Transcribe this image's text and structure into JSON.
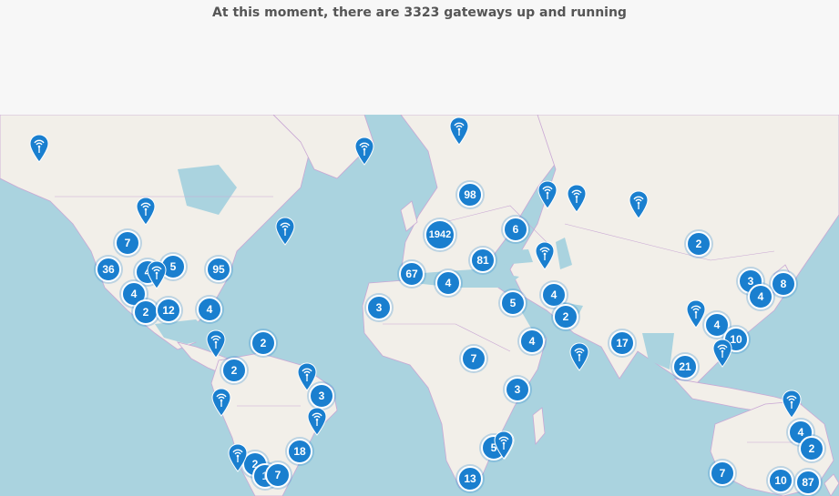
{
  "header": {
    "headline": "At this moment, there are 3323 gateways up and running"
  },
  "map": {
    "colors": {
      "water": "#aad3df",
      "land": "#f2efe9",
      "border": "#c9a7d4",
      "marker": "#1a7fcf"
    },
    "clusters": [
      {
        "name": "cluster-usa-north",
        "count": "7"
      },
      {
        "name": "cluster-usa-west",
        "count": "36"
      },
      {
        "name": "cluster-usa-central",
        "count": "4"
      },
      {
        "name": "cluster-usa-central-2",
        "count": "5"
      },
      {
        "name": "cluster-usa-east",
        "count": "95"
      },
      {
        "name": "cluster-usa-southwest",
        "count": "4"
      },
      {
        "name": "cluster-mexico-north",
        "count": "2"
      },
      {
        "name": "cluster-usa-texas",
        "count": "12"
      },
      {
        "name": "cluster-usa-southeast",
        "count": "4"
      },
      {
        "name": "cluster-caribbean",
        "count": "2"
      },
      {
        "name": "cluster-colombia",
        "count": "2"
      },
      {
        "name": "cluster-brazil-northeast",
        "count": "3"
      },
      {
        "name": "cluster-brazil-south",
        "count": "18"
      },
      {
        "name": "cluster-chile",
        "count": "2"
      },
      {
        "name": "cluster-argentina",
        "count": "1"
      },
      {
        "name": "cluster-uruguay",
        "count": "7"
      },
      {
        "name": "cluster-scandinavia",
        "count": "98"
      },
      {
        "name": "cluster-western-europe",
        "count": "1942"
      },
      {
        "name": "cluster-russia-west",
        "count": "6"
      },
      {
        "name": "cluster-iberia",
        "count": "67"
      },
      {
        "name": "cluster-balkans",
        "count": "81"
      },
      {
        "name": "cluster-italy-med",
        "count": "4"
      },
      {
        "name": "cluster-morocco",
        "count": "3"
      },
      {
        "name": "cluster-egypt",
        "count": "5"
      },
      {
        "name": "cluster-iran",
        "count": "4"
      },
      {
        "name": "cluster-gulf",
        "count": "2"
      },
      {
        "name": "cluster-ethiopia",
        "count": "4"
      },
      {
        "name": "cluster-west-africa",
        "count": "7"
      },
      {
        "name": "cluster-east-africa",
        "count": "3"
      },
      {
        "name": "cluster-south-africa-north",
        "count": "5"
      },
      {
        "name": "cluster-south-africa",
        "count": "13"
      },
      {
        "name": "cluster-india",
        "count": "17"
      },
      {
        "name": "cluster-china-north",
        "count": "2"
      },
      {
        "name": "cluster-korea",
        "count": "3"
      },
      {
        "name": "cluster-japan",
        "count": "8"
      },
      {
        "name": "cluster-japan-south",
        "count": "4"
      },
      {
        "name": "cluster-china-south",
        "count": "4"
      },
      {
        "name": "cluster-taiwan",
        "count": "10"
      },
      {
        "name": "cluster-malaysia",
        "count": "21"
      },
      {
        "name": "cluster-australia-queensland",
        "count": "4"
      },
      {
        "name": "cluster-australia-nsw",
        "count": "2"
      },
      {
        "name": "cluster-australia-west",
        "count": "7"
      },
      {
        "name": "cluster-australia-victoria",
        "count": "10"
      },
      {
        "name": "cluster-australia-southeast",
        "count": "87"
      }
    ],
    "pins": [
      {
        "name": "gateway-pin-alaska"
      },
      {
        "name": "gateway-pin-canada-west"
      },
      {
        "name": "gateway-pin-canada-east"
      },
      {
        "name": "gateway-pin-usa-central"
      },
      {
        "name": "gateway-pin-iceland"
      },
      {
        "name": "gateway-pin-norway"
      },
      {
        "name": "gateway-pin-russia-1"
      },
      {
        "name": "gateway-pin-russia-2"
      },
      {
        "name": "gateway-pin-russia-3"
      },
      {
        "name": "gateway-pin-turkey"
      },
      {
        "name": "gateway-pin-arabian-sea"
      },
      {
        "name": "gateway-pin-south-china"
      },
      {
        "name": "gateway-pin-philippines"
      },
      {
        "name": "gateway-pin-caribbean"
      },
      {
        "name": "gateway-pin-venezuela"
      },
      {
        "name": "gateway-pin-ecuador"
      },
      {
        "name": "gateway-pin-brazil-east"
      },
      {
        "name": "gateway-pin-brazil-southeast"
      },
      {
        "name": "gateway-pin-chile"
      },
      {
        "name": "gateway-pin-south-africa"
      },
      {
        "name": "gateway-pin-australia-northeast"
      }
    ]
  }
}
